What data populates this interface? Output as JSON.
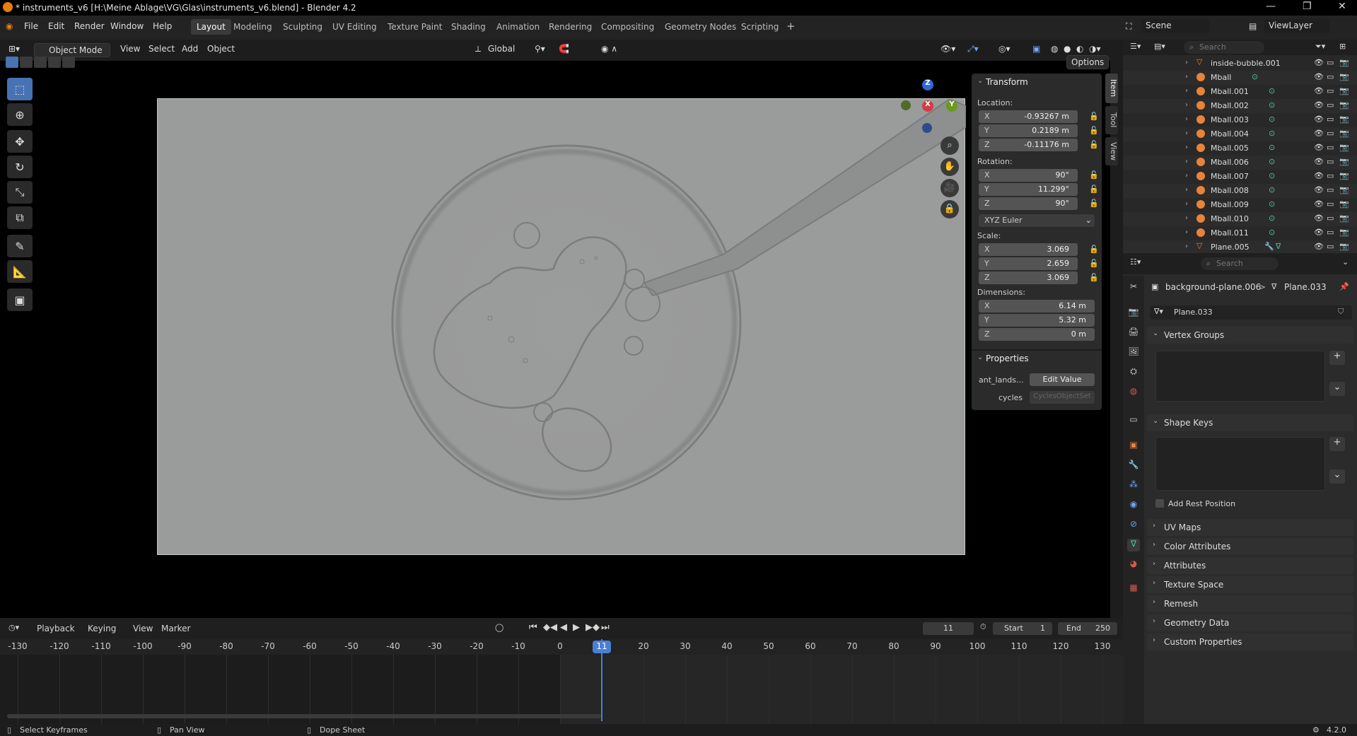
{
  "window": {
    "title": "* instruments_v6 [H:\\Meine Ablage\\VG\\Glas\\instruments_v6.blend] - Blender 4.2"
  },
  "menus": [
    "File",
    "Edit",
    "Render",
    "Window",
    "Help"
  ],
  "workspaces": [
    "Layout",
    "Modeling",
    "Sculpting",
    "UV Editing",
    "Texture Paint",
    "Shading",
    "Animation",
    "Rendering",
    "Compositing",
    "Geometry Nodes",
    "Scripting"
  ],
  "active_workspace": "Layout",
  "scene": {
    "label": "Scene",
    "viewlayer": "ViewLayer"
  },
  "viewport_header": {
    "mode": "Object Mode",
    "menus": [
      "View",
      "Select",
      "Add",
      "Object"
    ],
    "orientation": "Global",
    "options": "Options"
  },
  "gizmo": {
    "z": "Z",
    "x": "X",
    "y": "Y"
  },
  "npanel": {
    "tabs": [
      "Item",
      "Tool",
      "View"
    ],
    "transform_title": "Transform",
    "location_label": "Location:",
    "location": [
      {
        "ax": "X",
        "v": "-0.93267 m"
      },
      {
        "ax": "Y",
        "v": "0.2189 m"
      },
      {
        "ax": "Z",
        "v": "-0.11176 m"
      }
    ],
    "rotation_label": "Rotation:",
    "rotation": [
      {
        "ax": "X",
        "v": "90°"
      },
      {
        "ax": "Y",
        "v": "11.299°"
      },
      {
        "ax": "Z",
        "v": "90°"
      }
    ],
    "rotation_mode": "XYZ Euler",
    "scale_label": "Scale:",
    "scale": [
      {
        "ax": "X",
        "v": "3.069"
      },
      {
        "ax": "Y",
        "v": "2.659"
      },
      {
        "ax": "Z",
        "v": "3.069"
      }
    ],
    "dimensions_label": "Dimensions:",
    "dimensions": [
      {
        "ax": "X",
        "v": "6.14 m"
      },
      {
        "ax": "Y",
        "v": "5.32 m"
      },
      {
        "ax": "Z",
        "v": "0 m"
      }
    ],
    "properties_title": "Properties",
    "prop_name": "ant_lands...",
    "edit_value": "Edit Value",
    "cycles_label": "cycles",
    "cycles_value": "CyclesObjectSet"
  },
  "outliner": {
    "search_placeholder": "Search",
    "rows": [
      {
        "name": "inside-bubble.001",
        "type": "mesh"
      },
      {
        "name": "Mball",
        "type": "ball"
      },
      {
        "name": "Mball.001",
        "type": "ball"
      },
      {
        "name": "Mball.002",
        "type": "ball"
      },
      {
        "name": "Mball.003",
        "type": "ball"
      },
      {
        "name": "Mball.004",
        "type": "ball"
      },
      {
        "name": "Mball.005",
        "type": "ball"
      },
      {
        "name": "Mball.006",
        "type": "ball"
      },
      {
        "name": "Mball.007",
        "type": "ball"
      },
      {
        "name": "Mball.008",
        "type": "ball"
      },
      {
        "name": "Mball.009",
        "type": "ball"
      },
      {
        "name": "Mball.010",
        "type": "ball"
      },
      {
        "name": "Mball.011",
        "type": "ball"
      },
      {
        "name": "Plane.005",
        "type": "mesh"
      }
    ]
  },
  "properties": {
    "search_placeholder": "Search",
    "breadcrumb_object": "background-plane.006",
    "breadcrumb_sep": ">",
    "breadcrumb_data": "Plane.033",
    "data_name": "Plane.033",
    "vertex_groups": "Vertex Groups",
    "shape_keys": "Shape Keys",
    "add_rest_position": "Add Rest Position",
    "sections": [
      "UV Maps",
      "Color Attributes",
      "Attributes",
      "Texture Space",
      "Remesh",
      "Geometry Data",
      "Custom Properties"
    ]
  },
  "timeline": {
    "menus": [
      "Playback",
      "Keying",
      "View",
      "Marker"
    ],
    "current_frame": "11",
    "start_label": "Start",
    "start": "1",
    "end_label": "End",
    "end": "250",
    "ticks": [
      "-130",
      "-120",
      "-110",
      "-100",
      "-90",
      "-80",
      "-70",
      "-60",
      "-50",
      "-40",
      "-30",
      "-20",
      "-10",
      "0",
      "20",
      "30",
      "40",
      "50",
      "60",
      "70",
      "80",
      "90",
      "100",
      "110",
      "120",
      "130"
    ],
    "playhead": "11"
  },
  "status": {
    "left": "Select Keyframes",
    "mid": "Pan View",
    "right": "Dope Sheet",
    "version": "4.2.0"
  }
}
